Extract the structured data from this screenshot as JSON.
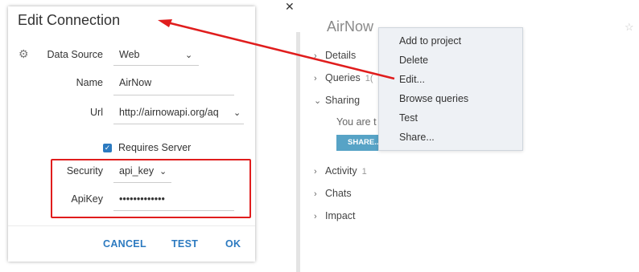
{
  "dialog": {
    "title": "Edit Connection",
    "fields": {
      "data_source": {
        "label": "Data Source",
        "value": "Web"
      },
      "name": {
        "label": "Name",
        "value": "AirNow"
      },
      "url": {
        "label": "Url",
        "value": "http://airnowapi.org/aq"
      },
      "requires_server": {
        "label": "Requires Server",
        "checked": true
      },
      "security": {
        "label": "Security",
        "value": "api_key"
      },
      "apikey": {
        "label": "ApiKey",
        "value": "•••••••••••••"
      }
    },
    "buttons": {
      "cancel": "CANCEL",
      "test": "TEST",
      "ok": "OK"
    }
  },
  "right_panel": {
    "title": "AirNow",
    "sections": [
      {
        "label": "Details"
      },
      {
        "label": "Queries",
        "count": "1("
      },
      {
        "label": "Sharing"
      },
      {
        "label": "Activity",
        "count": "1"
      },
      {
        "label": "Chats"
      },
      {
        "label": "Impact"
      }
    ],
    "sharing_text": "You are t",
    "share_button": "SHARE..."
  },
  "context_menu": {
    "items": [
      "Add to project",
      "Delete",
      "Edit...",
      "Browse queries",
      "Test",
      "Share..."
    ]
  },
  "icons": {
    "close": "close-icon",
    "settings": "gear-icon",
    "favorite": "star-icon",
    "expand": "chevron-right-icon",
    "collapse": "chevron-down-icon",
    "dropdown": "chevron-down-icon",
    "checkbox": "checkmark-icon"
  },
  "colors": {
    "accent": "#2c7ac0",
    "annotation": "#e01d1d",
    "share_button": "#57a3c6",
    "menu_bg": "#eef1f5"
  }
}
